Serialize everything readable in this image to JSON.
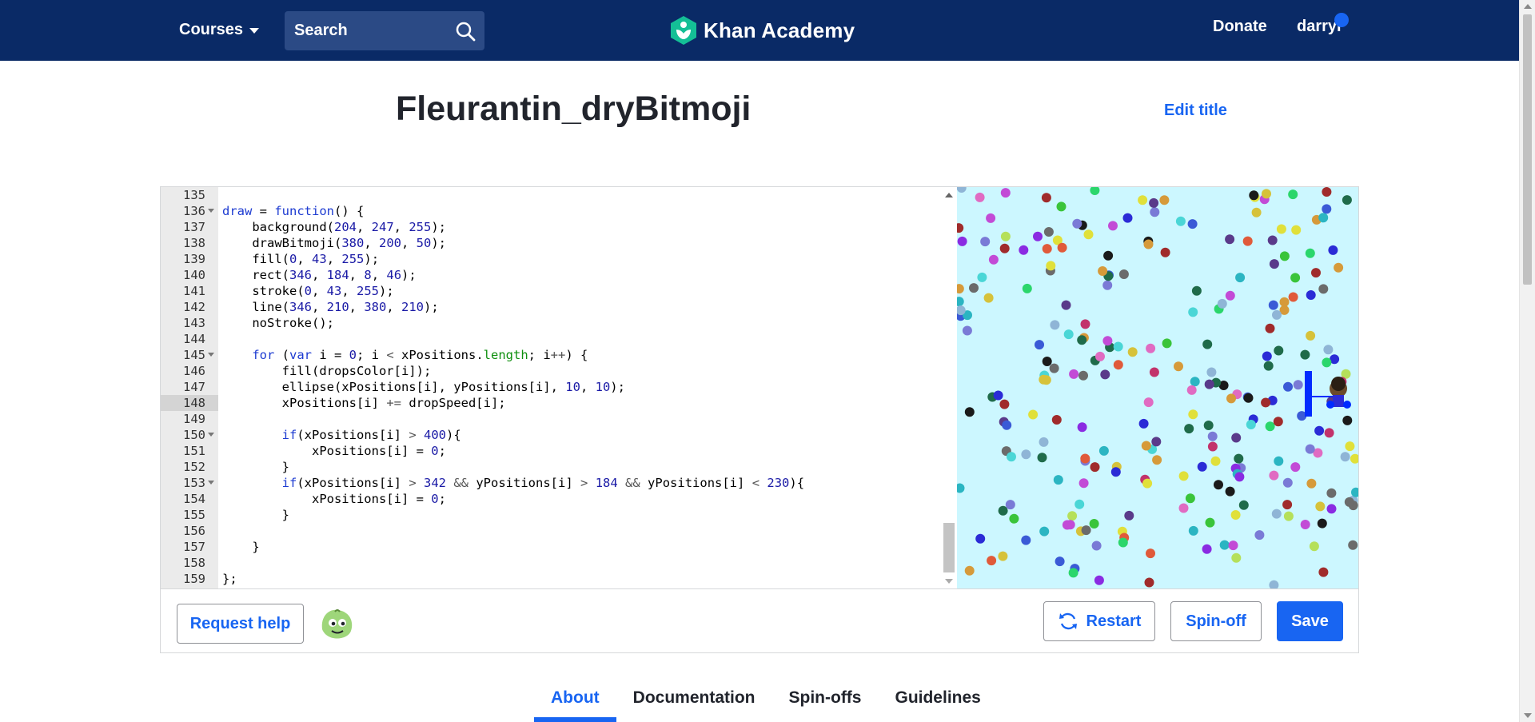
{
  "nav": {
    "courses_label": "Courses",
    "search_placeholder": "Search",
    "brand": "Khan Academy",
    "donate_label": "Donate",
    "user_label": "darryl"
  },
  "program": {
    "title": "Fleurantin_dryBitmoji",
    "edit_title_label": "Edit title"
  },
  "editor": {
    "active_line": 148,
    "lines": [
      {
        "n": 135,
        "fold": false,
        "html": ""
      },
      {
        "n": 136,
        "fold": true,
        "html": "<span class=\"kw\">draw</span> = <span class=\"kw\">function</span>() {"
      },
      {
        "n": 137,
        "fold": false,
        "html": "    background(<span class=\"num\">204</span>, <span class=\"num\">247</span>, <span class=\"num\">255</span>);"
      },
      {
        "n": 138,
        "fold": false,
        "html": "    drawBitmoji(<span class=\"num\">380</span>, <span class=\"num\">200</span>, <span class=\"num\">50</span>);"
      },
      {
        "n": 139,
        "fold": false,
        "html": "    fill(<span class=\"num\">0</span>, <span class=\"num\">43</span>, <span class=\"num\">255</span>);"
      },
      {
        "n": 140,
        "fold": false,
        "html": "    rect(<span class=\"num\">346</span>, <span class=\"num\">184</span>, <span class=\"num\">8</span>, <span class=\"num\">46</span>);"
      },
      {
        "n": 141,
        "fold": false,
        "html": "    stroke(<span class=\"num\">0</span>, <span class=\"num\">43</span>, <span class=\"num\">255</span>);"
      },
      {
        "n": 142,
        "fold": false,
        "html": "    line(<span class=\"num\">346</span>, <span class=\"num\">210</span>, <span class=\"num\">380</span>, <span class=\"num\">210</span>);"
      },
      {
        "n": 143,
        "fold": false,
        "html": "    noStroke();"
      },
      {
        "n": 144,
        "fold": false,
        "html": ""
      },
      {
        "n": 145,
        "fold": true,
        "html": "    <span class=\"kw\">for</span> (<span class=\"kw\">var</span> i = <span class=\"num\">0</span>; i <span class=\"op\">&lt;</span> xPositions.<span class=\"prop\">length</span>; i<span class=\"op\">++</span>) {"
      },
      {
        "n": 146,
        "fold": false,
        "html": "        fill(dropsColor[i]);"
      },
      {
        "n": 147,
        "fold": false,
        "html": "        ellipse(xPositions[i], yPositions[i], <span class=\"num\">10</span>, <span class=\"num\">10</span>);"
      },
      {
        "n": 148,
        "fold": false,
        "html": "        xPositions[i] <span class=\"op\">+=</span> dropSpeed[i];"
      },
      {
        "n": 149,
        "fold": false,
        "html": ""
      },
      {
        "n": 150,
        "fold": true,
        "html": "        <span class=\"kw\">if</span>(xPositions[i] <span class=\"op\">&gt;</span> <span class=\"num\">400</span>){"
      },
      {
        "n": 151,
        "fold": false,
        "html": "            xPositions[i] = <span class=\"num\">0</span>;"
      },
      {
        "n": 152,
        "fold": false,
        "html": "        }"
      },
      {
        "n": 153,
        "fold": true,
        "html": "        <span class=\"kw\">if</span>(xPositions[i] <span class=\"op\">&gt;</span> <span class=\"num\">342</span> <span class=\"op\">&amp;&amp;</span> yPositions[i] <span class=\"op\">&gt;</span> <span class=\"num\">184</span> <span class=\"op\">&amp;&amp;</span> yPositions[i] <span class=\"op\">&lt;</span> <span class=\"num\">230</span>){"
      },
      {
        "n": 154,
        "fold": false,
        "html": "            xPositions[i] = <span class=\"num\">0</span>;"
      },
      {
        "n": 155,
        "fold": false,
        "html": "        }"
      },
      {
        "n": 156,
        "fold": false,
        "html": ""
      },
      {
        "n": 157,
        "fold": false,
        "html": "    }"
      },
      {
        "n": 158,
        "fold": false,
        "html": ""
      },
      {
        "n": 159,
        "fold": false,
        "html": "};"
      }
    ]
  },
  "canvas": {
    "background": "#ccf7ff",
    "drop_colors": [
      "#2b2bd6",
      "#e05a3a",
      "#c24bd6",
      "#3ac43a",
      "#8a2be2",
      "#d6c23a",
      "#2bb5c2",
      "#7a7ad6",
      "#c2336b",
      "#1f6b4a",
      "#8fb5d6",
      "#d69a3a",
      "#5a3a8a",
      "#2bd66b",
      "#e0e03a",
      "#3a5ad6",
      "#b5e05a",
      "#6b6b6b",
      "#e06bc2",
      "#1a1a1a",
      "#4ad6d6",
      "#a02b2b"
    ]
  },
  "toolbar": {
    "help_label": "Request help",
    "restart_label": "Restart",
    "spinoff_label": "Spin-off",
    "save_label": "Save"
  },
  "tabs": [
    {
      "label": "About",
      "active": true
    },
    {
      "label": "Documentation",
      "active": false
    },
    {
      "label": "Spin-offs",
      "active": false
    },
    {
      "label": "Guidelines",
      "active": false
    }
  ]
}
